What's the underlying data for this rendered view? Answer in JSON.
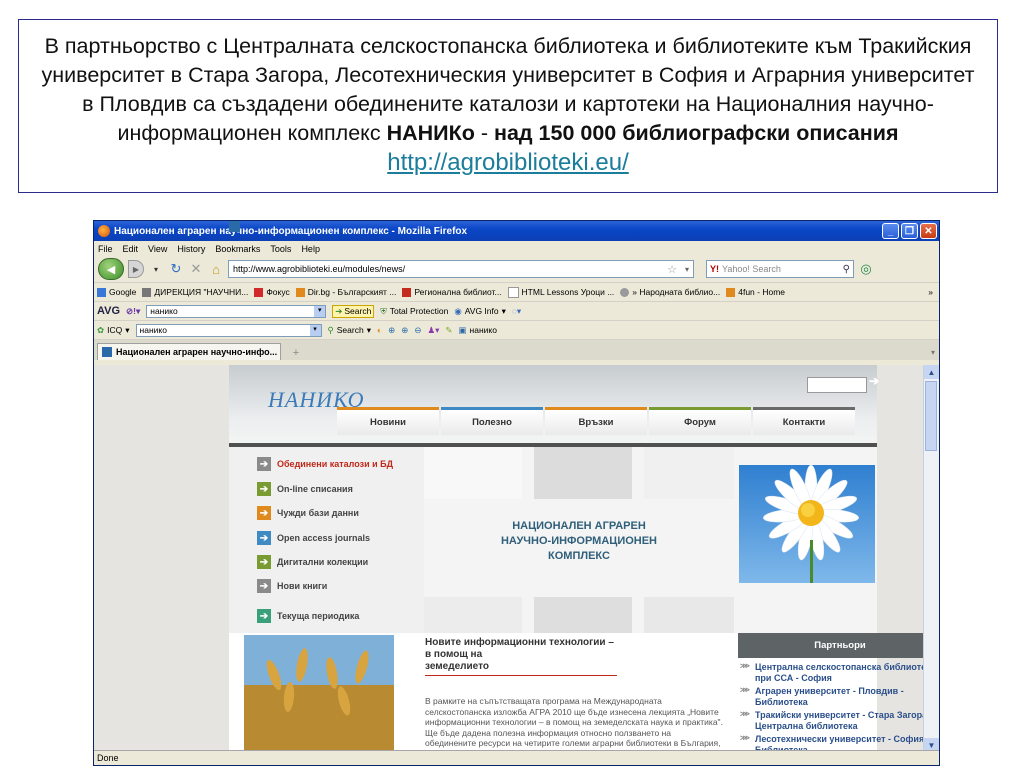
{
  "caption": {
    "part1": "В партньорство с Централната селскостопанска библиотека и библиотеките към Тракийския университет в Стара Загора, Лесотехническия университет в София и Аграрния университет в Пловдив са създадени обединените каталози и картотеки на Националния научно-информационен комплекс ",
    "brand": "НАНИКо",
    "dash": "  - ",
    "count": "над 150 000 библиографски описания",
    "link": "http://agrobiblioteki.eu/"
  },
  "browser": {
    "title": "Национален аграрен научно-информационен комплекс - Mozilla Firefox",
    "menu": [
      "File",
      "Edit",
      "View",
      "History",
      "Bookmarks",
      "Tools",
      "Help"
    ],
    "url": "http://www.agrobiblioteki.eu/modules/news/",
    "search_placeholder": "Yahoo! Search",
    "bookmarks": [
      {
        "label": "Google",
        "color": "#3a78d8"
      },
      {
        "label": "ДИРЕКЦИЯ \"НАУЧНИ...",
        "color": "#777777"
      },
      {
        "label": "Фокус",
        "color": "#d22a2a"
      },
      {
        "label": "Dir.bg - Българският ...",
        "color": "#e08a1e"
      },
      {
        "label": "Регионална библиот...",
        "color": "#c42a1e"
      },
      {
        "label": "HTML Lessons Уроци ...",
        "color": "#dddddd"
      },
      {
        "label": "» Народната библио...",
        "color": "#9a9a9a"
      },
      {
        "label": "4fun - Home",
        "color": "#e08a1e"
      }
    ],
    "toolbar2": {
      "avg": "AVG",
      "search_value": "нанико",
      "search_btn": "Search",
      "total_protection": "Total Protection",
      "avg_info": "AVG Info"
    },
    "toolbar3": {
      "icq": "ICQ",
      "value": "нанико",
      "search": "Search",
      "tail": "нанико"
    },
    "tab_title": "Национален аграрен научно-инфо...",
    "status": "Done"
  },
  "site": {
    "logo": "НАНИКО",
    "nav": [
      "Новини",
      "Полезно",
      "Връзки",
      "Форум",
      "Контакти"
    ],
    "menu": [
      {
        "label": "Обединени каталози и БД",
        "color": "#8a8a8a",
        "active": true
      },
      {
        "label": "On-line списания",
        "color": "#7a9a32"
      },
      {
        "label": "Чужди бази данни",
        "color": "#e08a1e"
      },
      {
        "label": "Open access journals",
        "color": "#3f8ac2"
      },
      {
        "label": "Дигитални колекции",
        "color": "#7a9a32"
      },
      {
        "label": "Нови книги",
        "color": "#8a8a8a"
      },
      {
        "label": "Текуща периодика",
        "color": "#3aa07a"
      }
    ],
    "banner_lines": [
      "НАЦИОНАЛЕН АГРАРЕН",
      "НАУЧНО-ИНФОРМАЦИОНЕН",
      "КОМПЛЕКС"
    ],
    "article": {
      "title_lines": [
        "Новите информационни технологии – в помощ на",
        "земеделието"
      ],
      "body": "В рамките на съпътстващата програма на Международната селскостопанска изложба АГРА 2010 ще бъде изнесена лекцията „Новите информационни технологии – в помощ на земеделската наука и практика\". Ще бъде дадена полезна информация относно ползването на обединените ресурси на четирите големи аграрни библиотеки в България, участващи в"
    },
    "partners_title": "Партньори",
    "partners": [
      "Централна селскостопанска библиотека при ССА - София",
      "Аграрен университет - Пловдив - Библиотека",
      "Тракийски университет - Стара Загора - Централна библиотека",
      "Лесотехнически университет - София - Библиотека"
    ]
  }
}
